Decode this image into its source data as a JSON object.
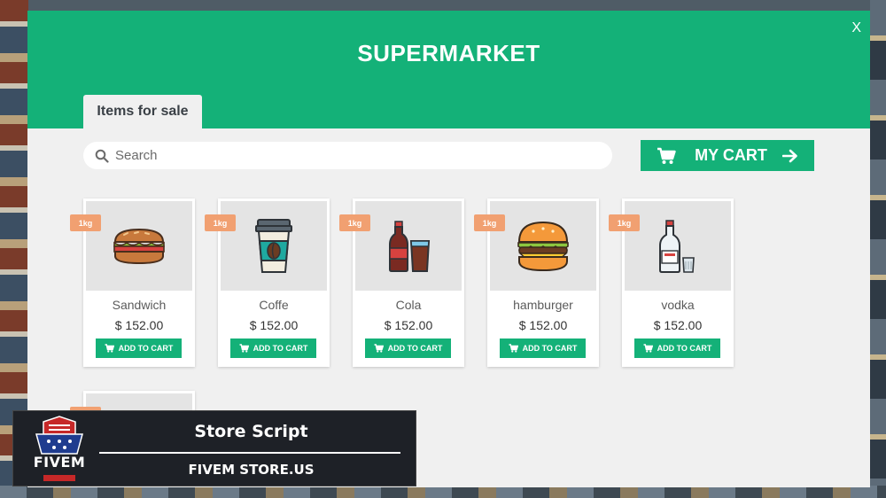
{
  "window": {
    "title": "SUPERMARKET",
    "close_label": "X"
  },
  "tabs": [
    {
      "label": "Items for sale",
      "active": true
    }
  ],
  "search": {
    "placeholder": "Search",
    "value": ""
  },
  "cart_button": {
    "label": "MY CART"
  },
  "items": [
    {
      "name": "Sandwich",
      "price": "$ 152.00",
      "weight": "1kg",
      "button": "ADD TO CART",
      "icon": "sandwich-icon"
    },
    {
      "name": "Coffe",
      "price": "$ 152.00",
      "weight": "1kg",
      "button": "ADD TO CART",
      "icon": "coffee-cup-icon"
    },
    {
      "name": "Cola",
      "price": "$ 152.00",
      "weight": "1kg",
      "button": "ADD TO CART",
      "icon": "cola-icon"
    },
    {
      "name": "hamburger",
      "price": "$ 152.00",
      "weight": "1kg",
      "button": "ADD TO CART",
      "icon": "hamburger-icon"
    },
    {
      "name": "vodka",
      "price": "$ 152.00",
      "weight": "1kg",
      "button": "ADD TO CART",
      "icon": "vodka-icon"
    }
  ],
  "overlay": {
    "logo_text": "FIVEM",
    "heading": "Store Script",
    "site": "FIVEM STORE.US"
  },
  "colors": {
    "accent": "#14b178",
    "badge": "#f1a071",
    "panel": "#f0f0f0"
  }
}
